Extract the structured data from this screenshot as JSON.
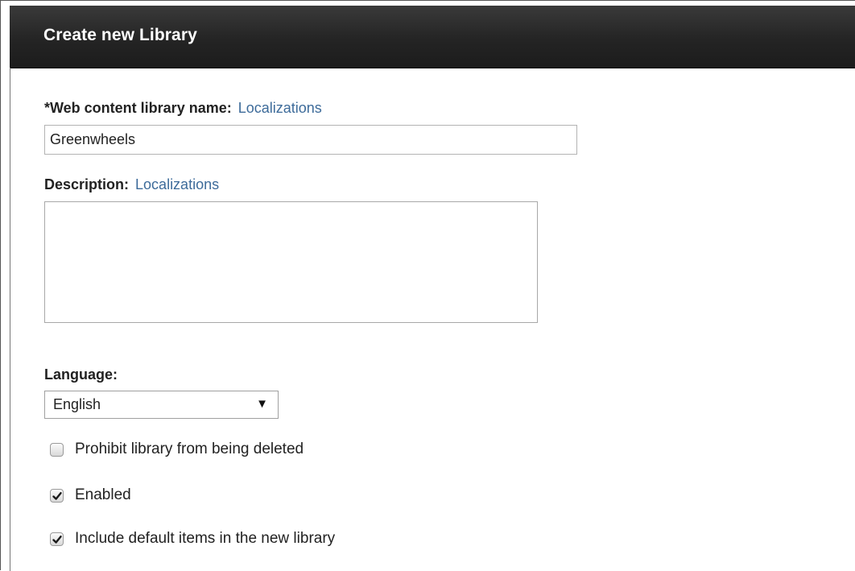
{
  "dialog": {
    "title": "Create new Library"
  },
  "fields": {
    "name": {
      "label": "*Web content library name:",
      "link": "Localizations",
      "value": "Greenwheels"
    },
    "description": {
      "label": "Description:",
      "link": "Localizations",
      "value": ""
    },
    "language": {
      "label": "Language:",
      "selected": "English"
    }
  },
  "options": [
    {
      "label": "Prohibit library from being deleted",
      "checked": false
    },
    {
      "label": "Enabled",
      "checked": true
    },
    {
      "label": "Include default items in the new library",
      "checked": true
    }
  ],
  "colors": {
    "titlebar": "#242424",
    "link": "#3d6b9a",
    "text": "#222222"
  },
  "icons": {
    "dropdown": "triangle-down",
    "check": "checkmark"
  }
}
